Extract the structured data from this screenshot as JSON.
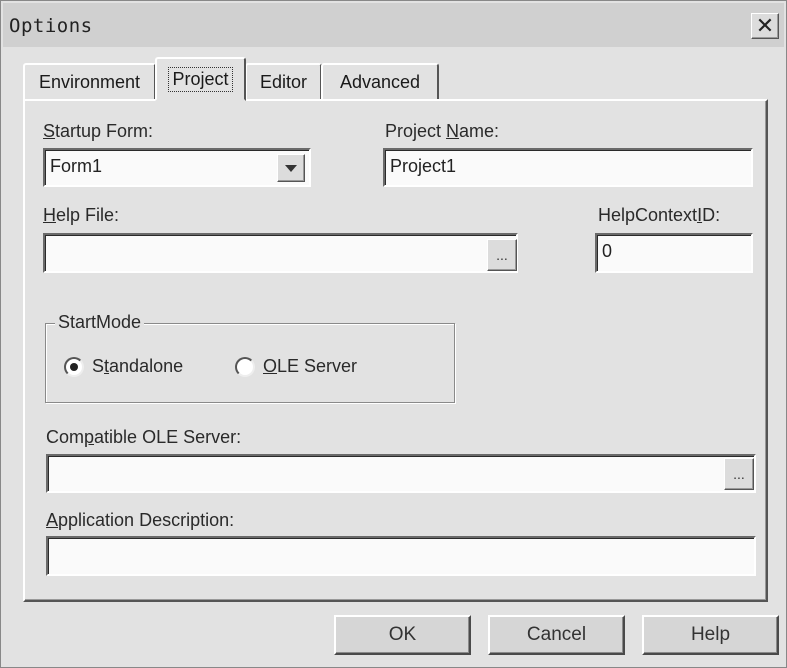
{
  "window": {
    "title": "Options",
    "close_glyph": "✕"
  },
  "tabs": [
    {
      "label": "Environment",
      "active": false
    },
    {
      "label": "Project",
      "active": true
    },
    {
      "label": "Editor",
      "active": false
    },
    {
      "label": "Advanced",
      "active": false
    }
  ],
  "project": {
    "startup_form": {
      "label": "Startup Form:",
      "mnemonic": "S",
      "value": "Form1"
    },
    "project_name": {
      "label": "Project Name:",
      "mnemonic": "N",
      "value": "Project1"
    },
    "help_file": {
      "label": "Help File:",
      "mnemonic": "H",
      "value": "",
      "browse_label": "..."
    },
    "help_context_id": {
      "label": "HelpContextID:",
      "mnemonic": "I",
      "value": "0"
    },
    "start_mode": {
      "legend": "StartMode",
      "options": [
        {
          "label": "Standalone",
          "mnemonic": "t",
          "selected": true
        },
        {
          "label": "OLE Server",
          "mnemonic": "O",
          "selected": false
        }
      ]
    },
    "compatible_ole_server": {
      "label": "Compatible OLE Server:",
      "mnemonic": "p",
      "value": "",
      "browse_label": "..."
    },
    "application_description": {
      "label": "Application Description:",
      "mnemonic": "A",
      "value": ""
    }
  },
  "buttons": {
    "ok": "OK",
    "cancel": "Cancel",
    "help": "Help"
  }
}
